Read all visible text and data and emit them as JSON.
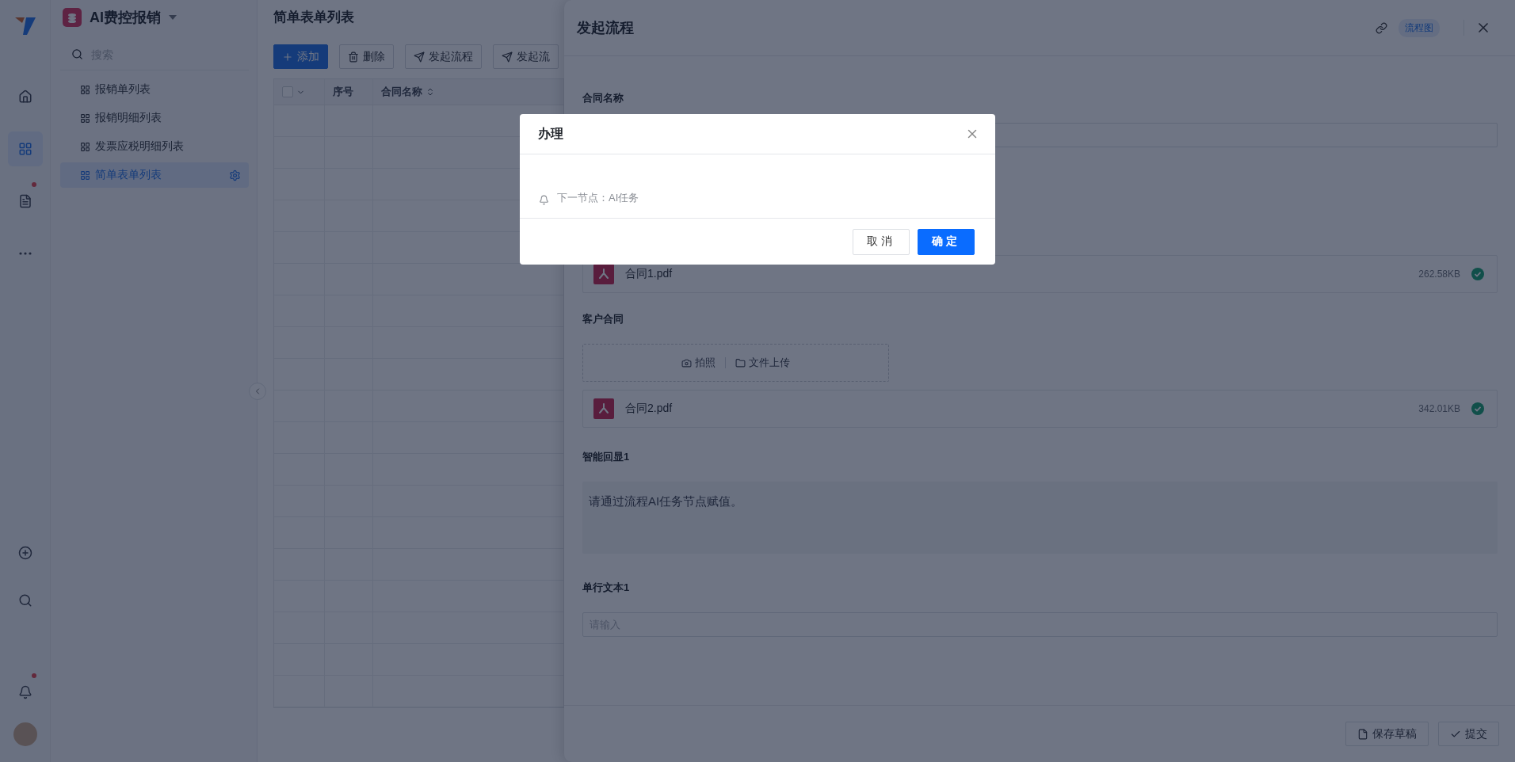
{
  "rail": {
    "top_items": [
      {
        "selected": false,
        "badge": false
      },
      {
        "selected": true,
        "badge": false
      },
      {
        "selected": false,
        "badge": true
      },
      {
        "selected": false,
        "badge": false
      }
    ],
    "bottom_items": [
      {
        "selected": false,
        "badge": false
      },
      {
        "selected": false,
        "badge": false
      },
      {
        "selected": false,
        "badge": true
      }
    ]
  },
  "nav": {
    "app_name": "AI费控报销",
    "search": {
      "placeholder": "搜索"
    },
    "items": [
      {
        "label": "报销单列表",
        "selected": false
      },
      {
        "label": "报销明细列表",
        "selected": false
      },
      {
        "label": "发票应税明细列表",
        "selected": false
      },
      {
        "label": "简单表单列表",
        "selected": true
      }
    ]
  },
  "main": {
    "title": "简单表单列表",
    "toolbar": [
      {
        "label": "添加",
        "primary": true
      },
      {
        "label": "删除",
        "primary": false
      },
      {
        "label": "发起流程",
        "primary": false
      },
      {
        "label": "发起流",
        "primary": false
      }
    ],
    "table": {
      "select_all": {
        "checked": false
      },
      "columns": [
        "序号",
        "合同名称"
      ]
    }
  },
  "drawer": {
    "title": "发起流程",
    "tag": "流程图",
    "sections": [
      {
        "kind": "input",
        "label": "合同名称"
      },
      {
        "kind": "files",
        "files": [
          {
            "name": "合同1.pdf",
            "size": "262.58KB",
            "done": true
          }
        ]
      },
      {
        "kind": "upload",
        "label": "客户合同",
        "actions": [
          "拍照",
          "文件上传"
        ],
        "files": [
          {
            "name": "合同2.pdf",
            "size": "342.01KB",
            "done": true
          }
        ]
      },
      {
        "kind": "note",
        "label": "智能回显1",
        "text": "请通过流程AI任务节点赋值。"
      },
      {
        "kind": "input",
        "label": "单行文本1",
        "placeholder": "请输入"
      }
    ],
    "buttons": [
      "保存草稿",
      "提交"
    ]
  },
  "dialog": {
    "title": "办理",
    "message": "下一节点：AI任务",
    "buttons": [
      {
        "label": "取消",
        "primary": false
      },
      {
        "label": "确定",
        "primary": true
      }
    ]
  }
}
